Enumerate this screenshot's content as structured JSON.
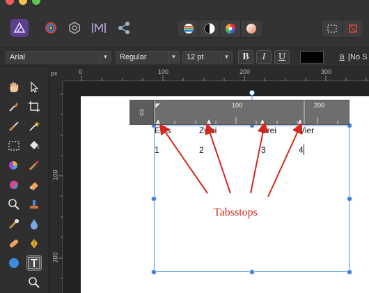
{
  "window": {
    "traffic_lights": [
      "close",
      "minimize",
      "zoom"
    ]
  },
  "personas": [
    {
      "name": "designer-persona-icon",
      "active": true
    },
    {
      "name": "pixel-persona-icon",
      "active": false
    },
    {
      "name": "export-persona-icon",
      "active": false
    },
    {
      "name": "studio-link-icon",
      "active": false
    },
    {
      "name": "share-icon",
      "active": false
    }
  ],
  "context": {
    "font_family": "Arial",
    "font_style": "Regular",
    "font_size": "12 pt",
    "bold_label": "B",
    "italic_label": "I",
    "underline_label": "U",
    "text_color": "#000000",
    "paragraph_style": "[No S"
  },
  "ruler": {
    "unit": "px",
    "h_labels": [
      "0",
      "100",
      "200",
      "300"
    ],
    "v_labels": [
      "100",
      "200"
    ]
  },
  "text_ruler": {
    "labels": [
      "100",
      "200"
    ]
  },
  "text_frame": {
    "headers": [
      "Eins",
      "Zwei",
      "Drei",
      "Vier"
    ],
    "values": [
      "1",
      "2",
      "3",
      "4"
    ]
  },
  "annotation": {
    "label": "Tabsstops",
    "color": "#d2281e"
  }
}
